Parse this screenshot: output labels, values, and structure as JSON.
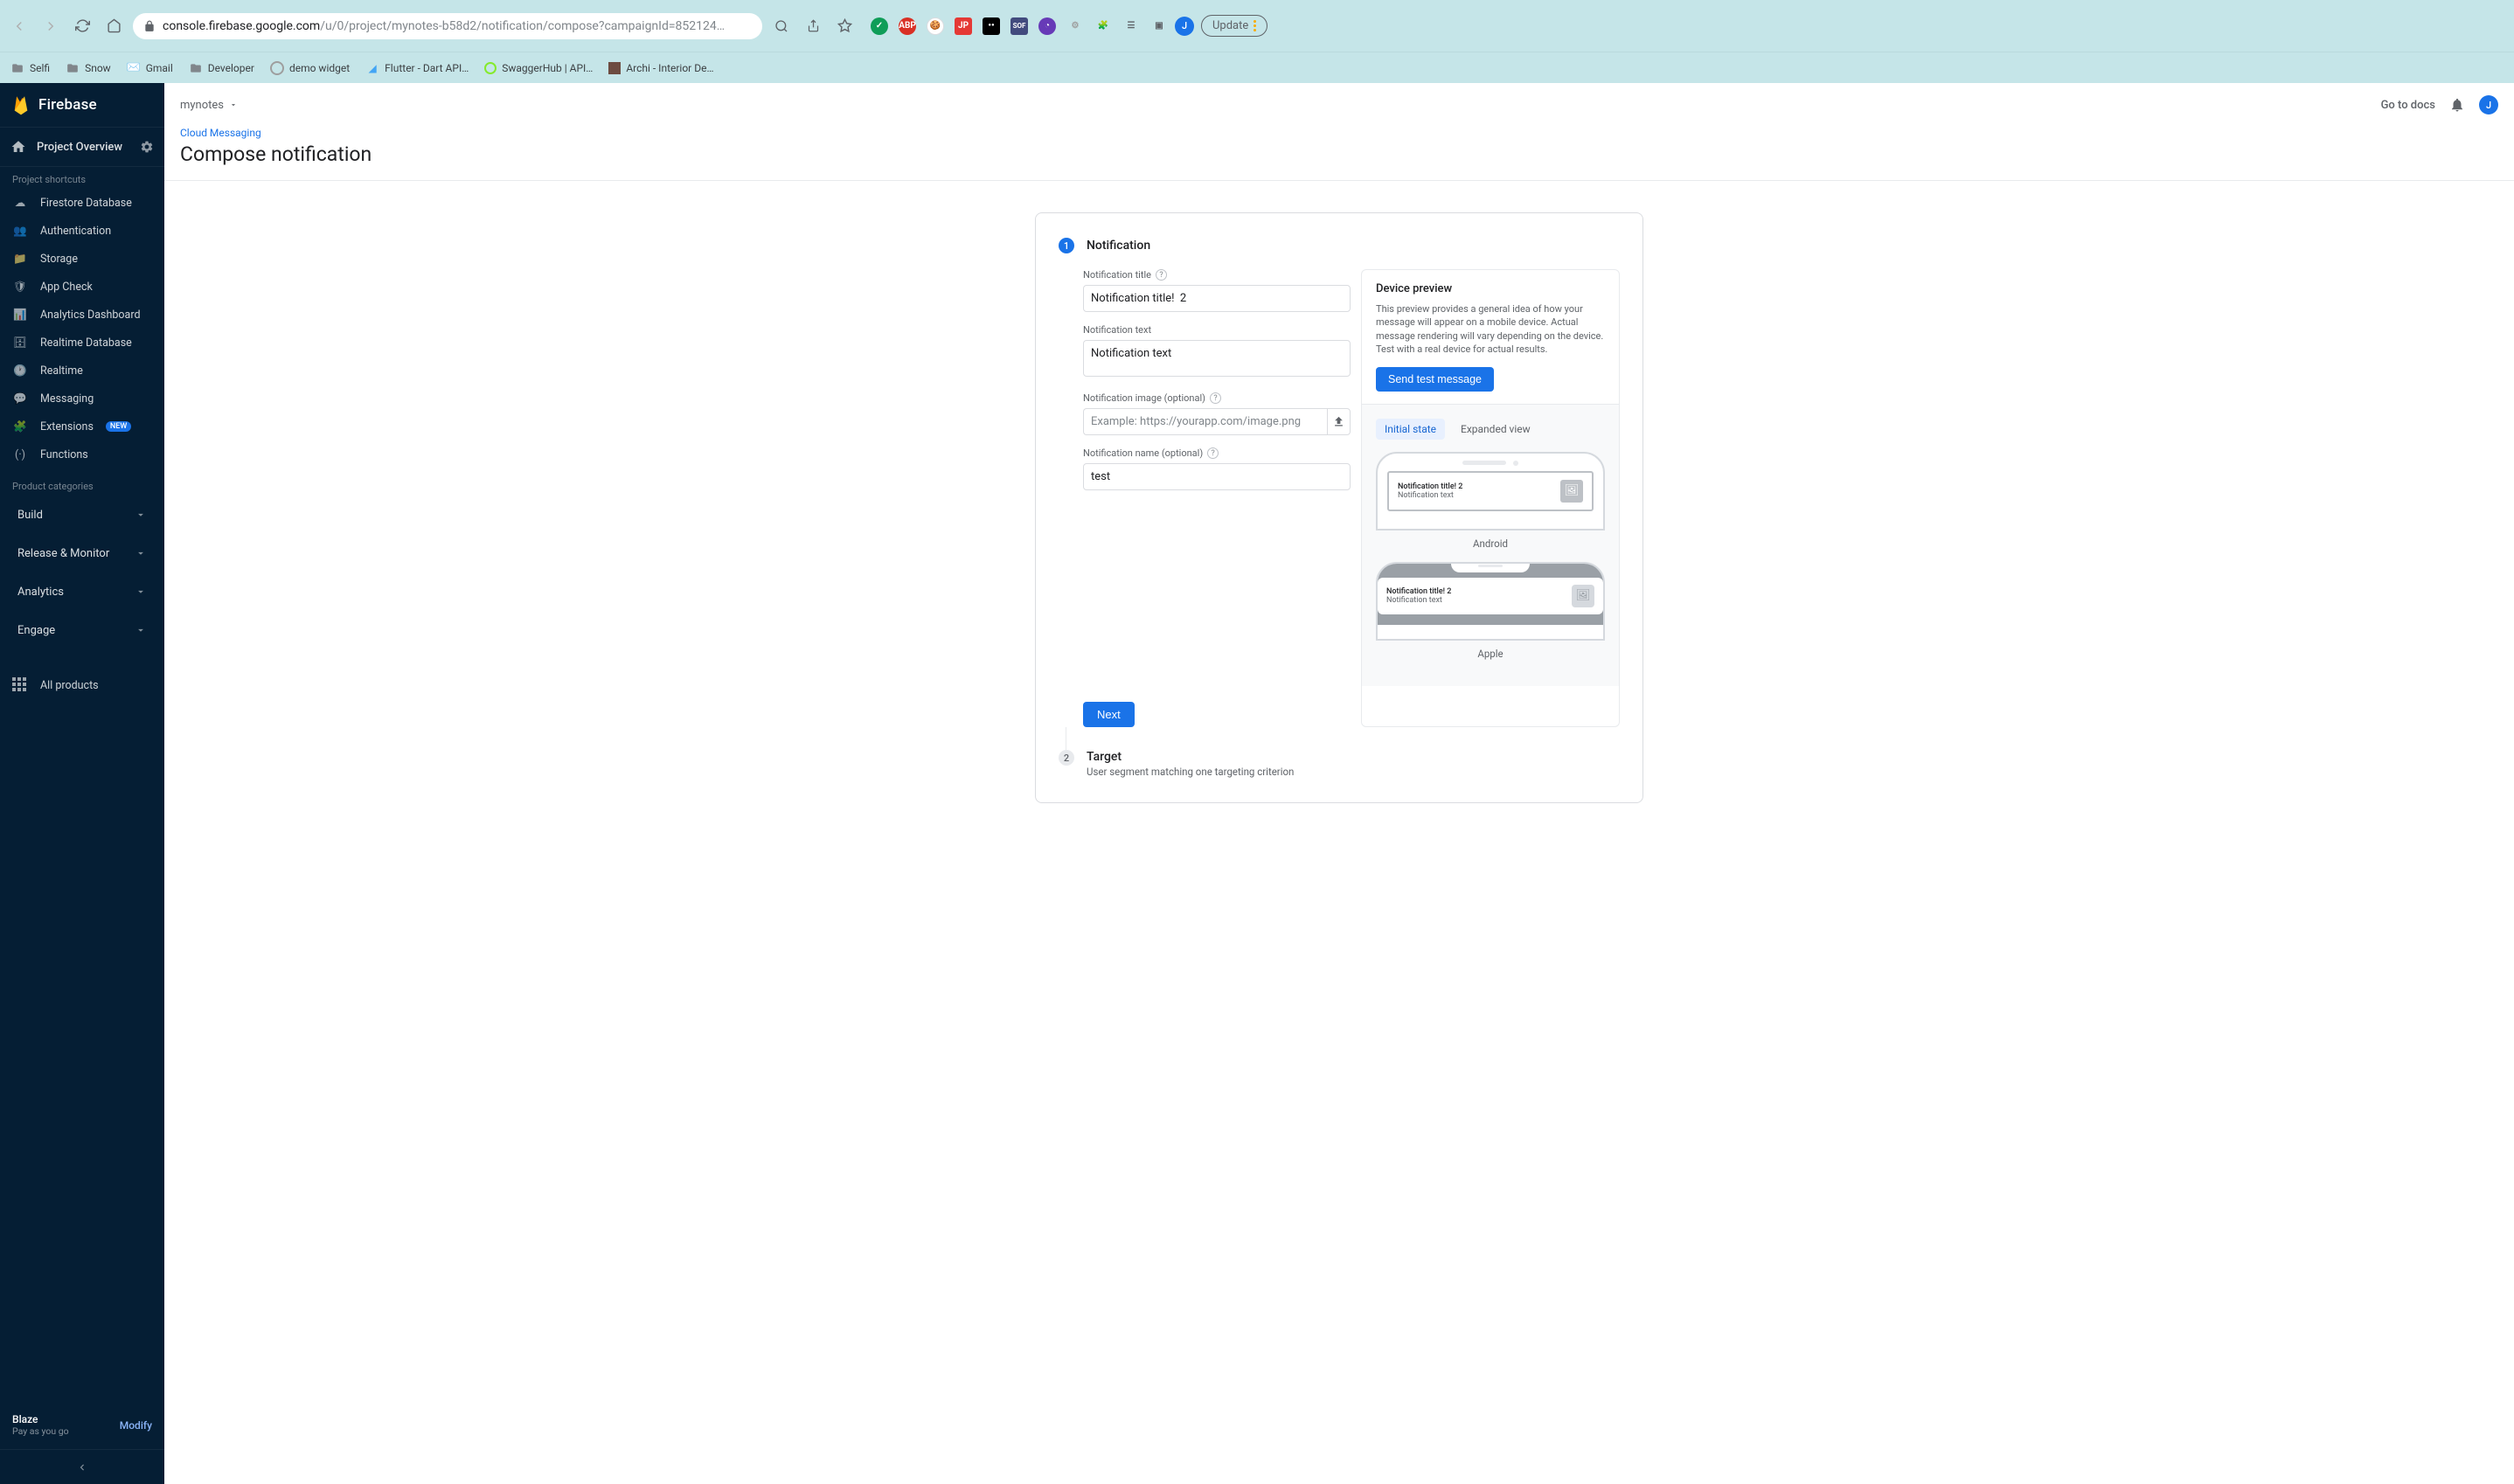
{
  "browser": {
    "url_host": "console.firebase.google.com",
    "url_path": "/u/0/project/mynotes-b58d2/notification/compose?campaignId=852124…",
    "update_label": "Update",
    "avatar_initial": "J",
    "bookmarks": [
      {
        "label": "Selfi",
        "type": "folder"
      },
      {
        "label": "Snow",
        "type": "folder"
      },
      {
        "label": "Gmail",
        "type": "gmail"
      },
      {
        "label": "Developer",
        "type": "folder"
      },
      {
        "label": "demo widget",
        "type": "site"
      },
      {
        "label": "Flutter - Dart API…",
        "type": "flutter"
      },
      {
        "label": "SwaggerHub | API…",
        "type": "swagger"
      },
      {
        "label": "Archi - Interior De…",
        "type": "site"
      }
    ]
  },
  "topbar": {
    "project_name": "mynotes",
    "docs_label": "Go to docs",
    "avatar_initial": "J"
  },
  "page": {
    "breadcrumb": "Cloud Messaging",
    "title": "Compose notification"
  },
  "sidebar": {
    "brand": "Firebase",
    "overview": "Project Overview",
    "shortcuts_header": "Project shortcuts",
    "shortcuts": [
      {
        "label": "Firestore Database",
        "icon": "layers"
      },
      {
        "label": "Authentication",
        "icon": "people"
      },
      {
        "label": "Storage",
        "icon": "folder"
      },
      {
        "label": "App Check",
        "icon": "shield"
      },
      {
        "label": "Analytics Dashboard",
        "icon": "chart"
      },
      {
        "label": "Realtime Database",
        "icon": "database"
      },
      {
        "label": "Realtime",
        "icon": "clock"
      },
      {
        "label": "Messaging",
        "icon": "message"
      },
      {
        "label": "Extensions",
        "icon": "puzzle",
        "badge": "NEW"
      },
      {
        "label": "Functions",
        "icon": "functions"
      }
    ],
    "categories_header": "Product categories",
    "categories": [
      {
        "label": "Build"
      },
      {
        "label": "Release & Monitor"
      },
      {
        "label": "Analytics"
      },
      {
        "label": "Engage"
      }
    ],
    "all_products": "All products",
    "plan": {
      "name": "Blaze",
      "sub": "Pay as you go",
      "modify": "Modify"
    }
  },
  "form": {
    "step1_num": "1",
    "step1_title": "Notification",
    "title_label": "Notification title",
    "title_value": "Notification title!  2",
    "text_label": "Notification text",
    "text_value": "Notification text",
    "image_label": "Notification image (optional)",
    "image_placeholder": "Example: https://yourapp.com/image.png",
    "name_label": "Notification name (optional)",
    "name_value": "test",
    "next_label": "Next",
    "step2_num": "2",
    "step2_title": "Target",
    "step2_sub": "User segment matching one targeting criterion"
  },
  "preview": {
    "header": "Device preview",
    "description": "This preview provides a general idea of how your message will appear on a mobile device. Actual message rendering will vary depending on the device. Test with a real device for actual results.",
    "test_button": "Send test message",
    "tab_initial": "Initial state",
    "tab_expanded": "Expanded view",
    "notif_title": "Notification title!  2",
    "notif_text": "Notification text",
    "android_label": "Android",
    "apple_label": "Apple"
  }
}
